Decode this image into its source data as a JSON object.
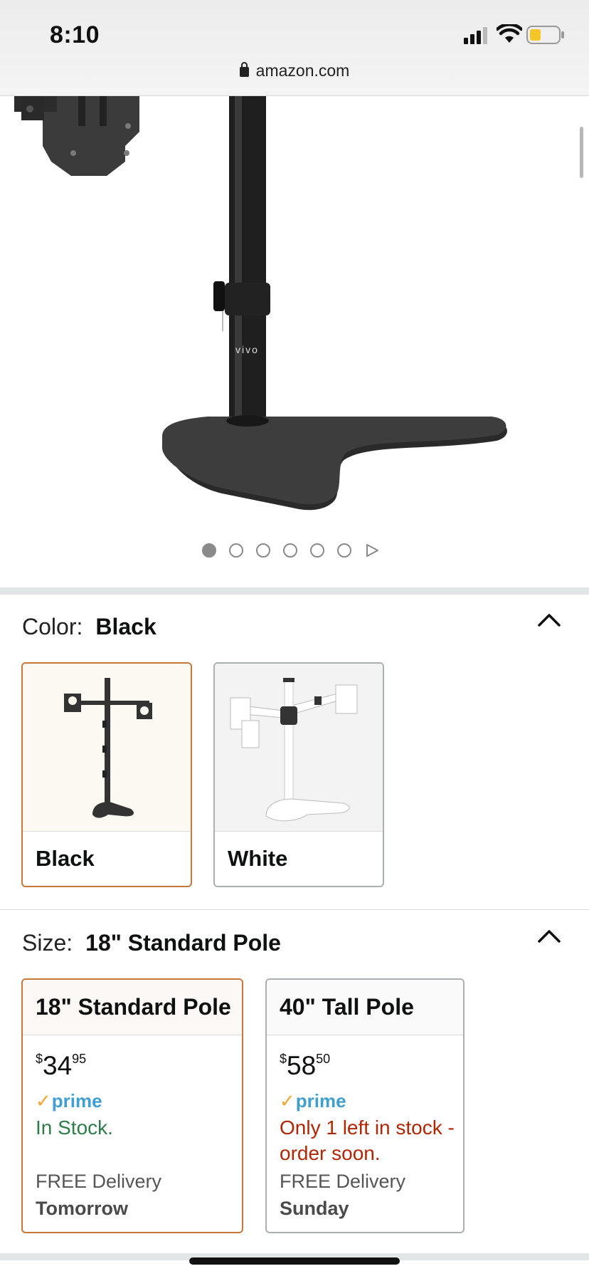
{
  "status_bar": {
    "time": "8:10",
    "url": "amazon.com"
  },
  "product_gallery": {
    "brand_mark": "vivo",
    "page_count": 6,
    "active_index": 0
  },
  "color": {
    "label": "Color:",
    "selected": "Black",
    "options": [
      {
        "name": "Black",
        "selected": true
      },
      {
        "name": "White",
        "selected": false
      }
    ]
  },
  "size": {
    "label": "Size:",
    "selected": "18\" Standard Pole",
    "options": [
      {
        "title": "18\" Standard Pole",
        "price_symbol": "$",
        "price_whole": "34",
        "price_fraction": "95",
        "prime": "prime",
        "stock": "In Stock.",
        "delivery": "FREE Delivery",
        "delivery_day": "Tomorrow",
        "selected": true
      },
      {
        "title": "40\" Tall Pole",
        "price_symbol": "$",
        "price_whole": "58",
        "price_fraction": "50",
        "prime": "prime",
        "stock": "Only 1 left in stock - order soon.",
        "delivery": "FREE Delivery",
        "delivery_day": "Sunday",
        "selected": false
      }
    ]
  },
  "colors": {
    "selected_border": "#c7773a",
    "in_stock": "#2e7d4a",
    "low_stock": "#b12704",
    "prime_blue": "#3f9fd0",
    "prime_check": "#f7a532"
  }
}
